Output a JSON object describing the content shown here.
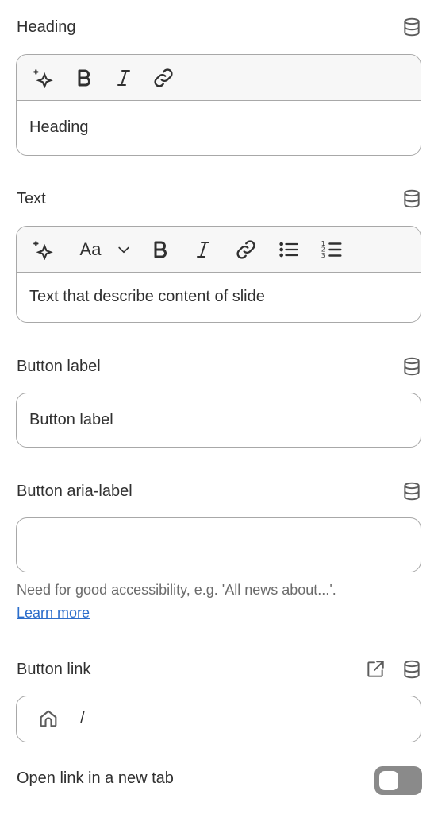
{
  "heading_field": {
    "label": "Heading",
    "value": "Heading",
    "toolbar": [
      "sparkle-icon",
      "bold-icon",
      "italic-icon",
      "link-icon"
    ]
  },
  "text_field": {
    "label": "Text",
    "value": "Text that describe content of slide",
    "toolbar": [
      "sparkle-icon",
      "font-size-icon",
      "chevron-down-icon",
      "bold-icon",
      "italic-icon",
      "link-icon",
      "bulleted-list-icon",
      "numbered-list-icon"
    ],
    "font_glyph": "Aa"
  },
  "button_label_field": {
    "label": "Button label",
    "value": "Button label"
  },
  "button_aria_field": {
    "label": "Button aria-label",
    "value": "",
    "help": "Need for good accessibility, e.g. 'All news about...'.",
    "learn_more": "Learn more"
  },
  "button_link_field": {
    "label": "Button link",
    "value": "/"
  },
  "new_tab": {
    "label": "Open link in a new tab",
    "checked": false
  }
}
